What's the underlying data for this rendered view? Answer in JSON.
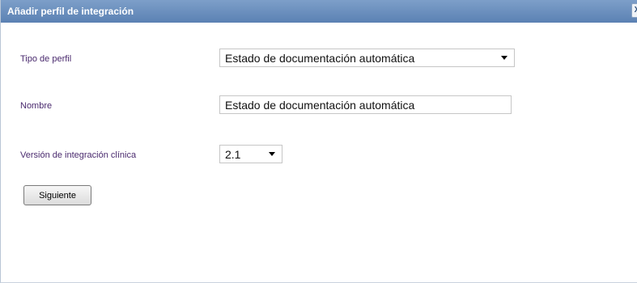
{
  "dialog": {
    "title": "Añadir perfil de integración",
    "close_glyph": "X"
  },
  "form": {
    "profile_type": {
      "label": "Tipo de perfil",
      "selected": "Estado de documentación automática"
    },
    "name": {
      "label": "Nombre",
      "value": "Estado de documentación automática"
    },
    "clinical_version": {
      "label": "Versión de integración clínica",
      "selected": "2.1"
    },
    "next_button": "Siguiente"
  },
  "colors": {
    "titlebar": "#5b81b3",
    "label_text": "#4a2a6e"
  }
}
